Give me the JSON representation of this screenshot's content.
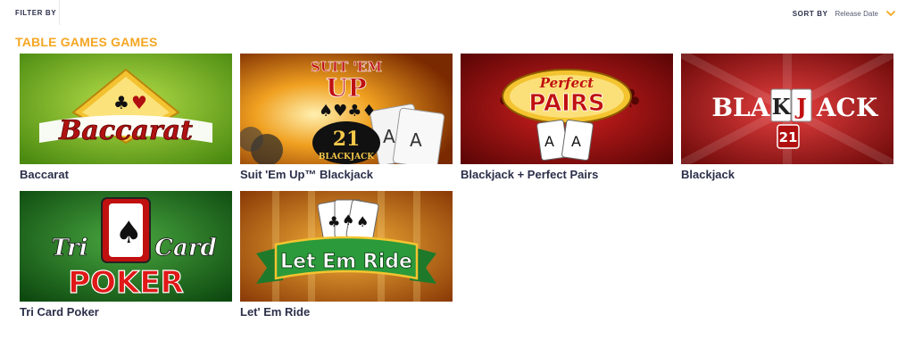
{
  "toolbar": {
    "filter_label": "FILTER BY",
    "sort_label": "SORT BY",
    "sort_value": "Release Date"
  },
  "section": {
    "title": "TABLE GAMES GAMES"
  },
  "games": [
    {
      "title": "Baccarat",
      "art_text": "Baccarat"
    },
    {
      "title": "Suit 'Em Up™ Blackjack",
      "art_text_1": "SUIT 'EM",
      "art_text_2": "UP",
      "art_text_3": "21",
      "art_text_4": "BLACKJACK"
    },
    {
      "title": "Blackjack + Perfect Pairs",
      "art_text_1": "Perfect",
      "art_text_2": "PAIRS"
    },
    {
      "title": "Blackjack",
      "art_text_1": "BLAC",
      "art_text_2": "K",
      "art_text_3": "J",
      "art_text_4": "ACK",
      "art_text_5": "21"
    },
    {
      "title": "Tri Card Poker",
      "art_text_1": "Tri",
      "art_text_2": "Card",
      "art_text_3": "POKER"
    },
    {
      "title": "Let' Em Ride",
      "art_text": "Let Em Ride"
    }
  ],
  "colors": {
    "accent": "#f5a623",
    "text_dark": "#2b2f4a"
  }
}
